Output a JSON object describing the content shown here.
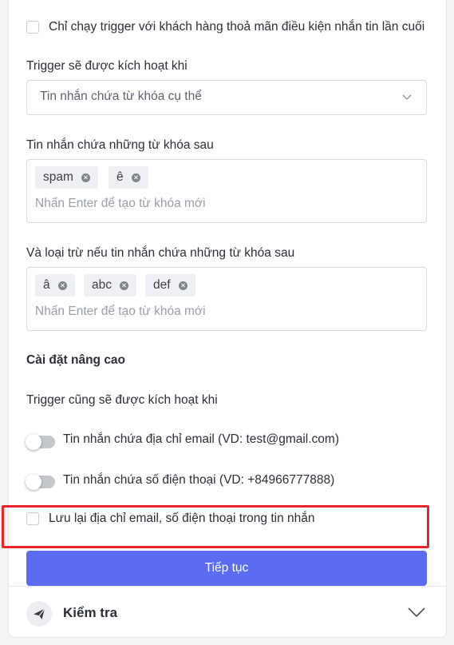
{
  "trigger_condition": {
    "last_message_checkbox_label": "Chỉ chạy trigger với khách hàng thoả mãn điều kiện nhắn tin lần cuối",
    "activation_label": "Trigger sẽ được kích hoạt khi",
    "activation_select_value": "Tin nhắn chứa từ khóa cụ thể"
  },
  "include_keywords": {
    "label": "Tin nhắn chứa những từ khóa sau",
    "tags": [
      "spam",
      "ê"
    ],
    "placeholder": "Nhấn Enter để tạo từ khóa mới"
  },
  "exclude_keywords": {
    "label": "Và loại trừ nếu tin nhắn chứa những từ khóa sau",
    "tags": [
      "â",
      "abc",
      "def"
    ],
    "placeholder": "Nhấn Enter để tạo từ khóa mới"
  },
  "advanced": {
    "heading": "Cài đặt nâng cao",
    "also_trigger_label": "Trigger cũng sẽ được kích hoạt khi",
    "email_toggle_label": "Tin nhắn chứa địa chỉ email (VD: test@gmail.com)",
    "phone_toggle_label": "Tin nhắn chứa số điện thoại (VD: +84966777888)",
    "save_contact_checkbox_label": "Lưu lại địa chỉ email, số điện thoại trong tin nhắn"
  },
  "actions": {
    "continue_label": "Tiếp tục"
  },
  "footer": {
    "title": "Kiểm tra",
    "icon": "send-icon"
  },
  "colors": {
    "primary": "#5b6cf2",
    "highlight": "#e8262b",
    "toggle_off": "#c4c7cc"
  }
}
